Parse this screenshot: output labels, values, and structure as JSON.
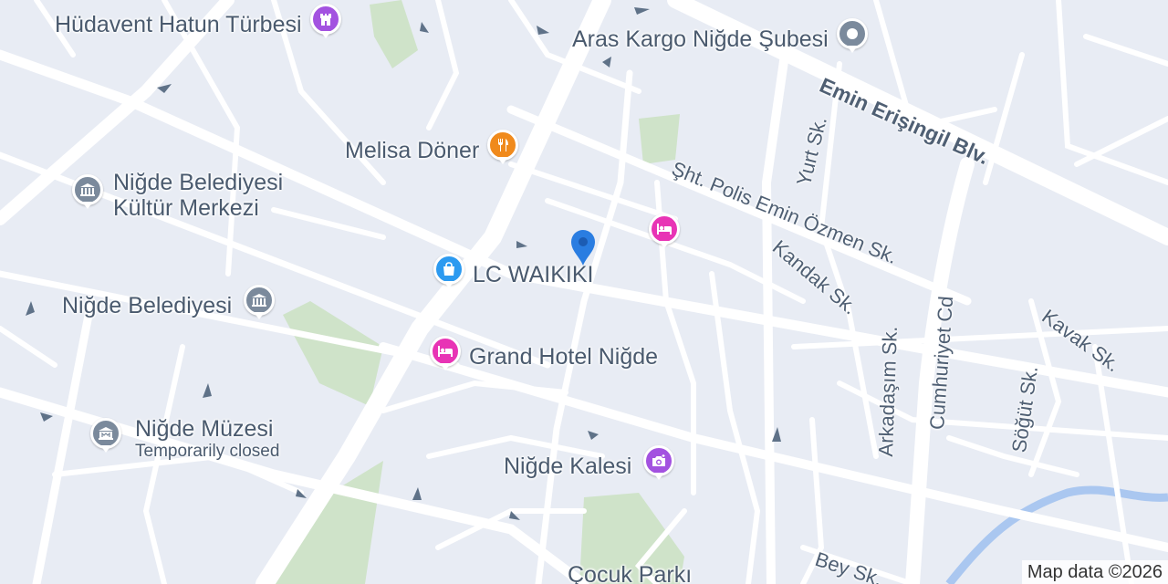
{
  "map": {
    "colors": {
      "background": "#e8ecf4",
      "road": "#ffffff",
      "park": "#cfe3c9",
      "water": "#aac7f0",
      "attraction": "#a352e0",
      "generic": "#7b8a9c",
      "food": "#f08a1c",
      "hotel": "#e834b5",
      "shopping": "#2c9af0",
      "civic": "#7b8a9c",
      "location_pin": "#2a7de1"
    },
    "pois": [
      {
        "id": "hudavent",
        "name": "Hüdavent Hatun Türbesi",
        "icon": "tower-icon",
        "category": "attraction"
      },
      {
        "id": "aras",
        "name": "Aras Kargo Niğde Şubesi",
        "icon": "pin-dot-icon",
        "category": "generic"
      },
      {
        "id": "melisa",
        "name": "Melisa Döner",
        "icon": "fork-knife-icon",
        "category": "food"
      },
      {
        "id": "kultur",
        "name_line1": "Niğde Belediyesi",
        "name_line2": "Kültür Merkezi",
        "icon": "civic-building-icon",
        "category": "civic"
      },
      {
        "id": "lcwaikiki",
        "name": "LC WAIKIKI",
        "icon": "shopping-bag-icon",
        "category": "shopping"
      },
      {
        "id": "belediye",
        "name": "Niğde Belediyesi",
        "icon": "civic-building-icon",
        "category": "civic"
      },
      {
        "id": "grandhotel",
        "name": "Grand Hotel Niğde",
        "icon": "bed-icon",
        "category": "hotel"
      },
      {
        "id": "hotel2",
        "name": "",
        "icon": "bed-icon",
        "category": "hotel"
      },
      {
        "id": "muzesi",
        "name": "Niğde Müzesi",
        "status": "Temporarily closed",
        "icon": "museum-icon",
        "category": "civic"
      },
      {
        "id": "kalesi",
        "name": "Niğde Kalesi",
        "icon": "camera-icon",
        "category": "attraction"
      },
      {
        "id": "cocukparki",
        "name": "Çocuk Parkı",
        "icon": "",
        "category": "park"
      }
    ],
    "streets": [
      {
        "id": "emin-erisingil",
        "name": "Emin Erişingil Blv."
      },
      {
        "id": "sht-polis",
        "name": "Şht. Polis Emin Özmen Sk."
      },
      {
        "id": "yurt",
        "name": "Yurt Sk."
      },
      {
        "id": "kandak",
        "name": "Kandak Sk."
      },
      {
        "id": "arkadasim",
        "name": "Arkadaşım Sk."
      },
      {
        "id": "cumhuriyet",
        "name": "Cumhuriyet Cd"
      },
      {
        "id": "sogut",
        "name": "Söğüt Sk."
      },
      {
        "id": "kavak",
        "name": "Kavak Sk."
      },
      {
        "id": "bey",
        "name": "Bey Sk."
      }
    ],
    "attribution": "Map data ©2026"
  }
}
